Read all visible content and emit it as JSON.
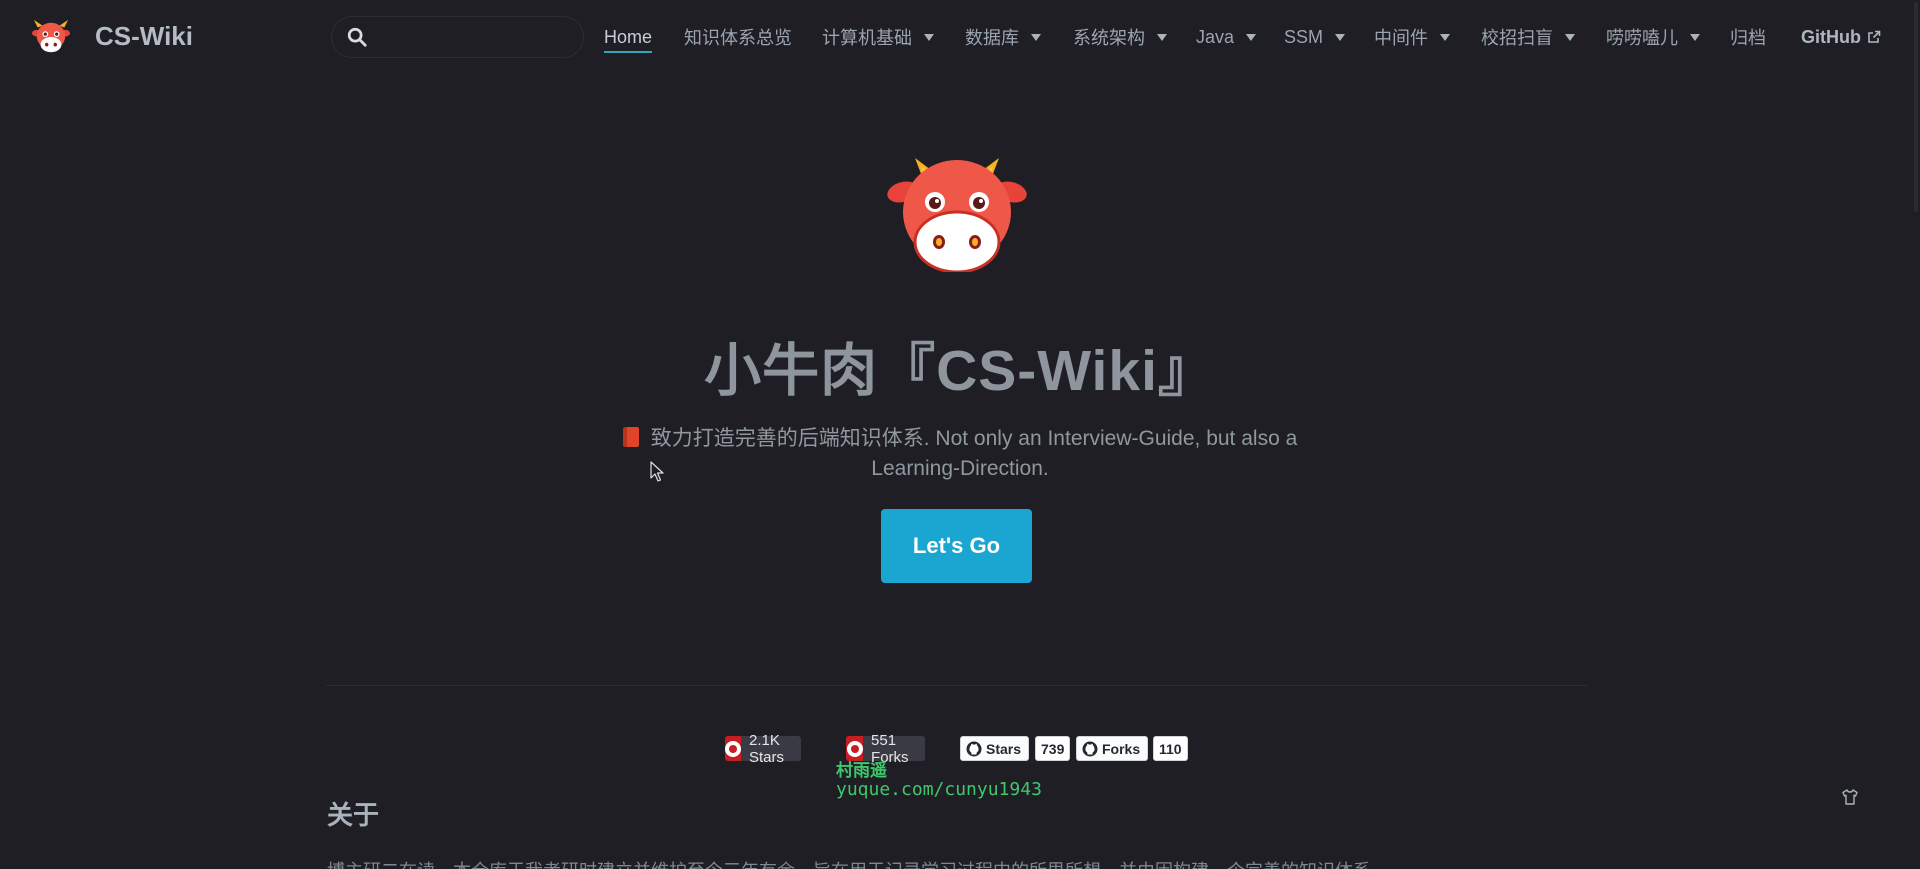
{
  "brand": {
    "title": "CS-Wiki"
  },
  "search": {
    "placeholder": ""
  },
  "nav": {
    "items": [
      {
        "label": "Home",
        "dropdown": false,
        "active": true
      },
      {
        "label": "知识体系总览",
        "dropdown": false
      },
      {
        "label": "计算机基础",
        "dropdown": true
      },
      {
        "label": "数据库",
        "dropdown": true
      },
      {
        "label": "系统架构",
        "dropdown": true
      },
      {
        "label": "Java",
        "dropdown": true
      },
      {
        "label": "SSM",
        "dropdown": true
      },
      {
        "label": "中间件",
        "dropdown": true
      },
      {
        "label": "校招扫盲",
        "dropdown": true
      },
      {
        "label": "唠唠嗑儿",
        "dropdown": true
      },
      {
        "label": "归档",
        "dropdown": false
      },
      {
        "label": "GitHub",
        "dropdown": false,
        "external": true
      }
    ]
  },
  "hero": {
    "title": "小牛肉『CS-Wiki』",
    "description": "致力打造完善的后端知识体系. Not only an Interview-Guide, but also a Learning-Direction.",
    "cta_label": "Let's Go"
  },
  "badges": {
    "gitee_stars": "2.1K Stars",
    "gitee_forks": "551 Forks",
    "gh_stars_label": "Stars",
    "gh_stars_count": "739",
    "gh_forks_label": "Forks",
    "gh_forks_count": "110"
  },
  "watermark": {
    "name": "村雨遥",
    "url": "yuque.com/cunyu1943"
  },
  "about": {
    "title": "关于",
    "text": "博主研二在读，本仓库于我考研时建立并维护至今三年有余，旨在用于记录学习过程中的所思所想，并由因构建一个完善的知识体系"
  },
  "colors": {
    "accent": "#1aa6d1",
    "background": "#1f1e24"
  }
}
